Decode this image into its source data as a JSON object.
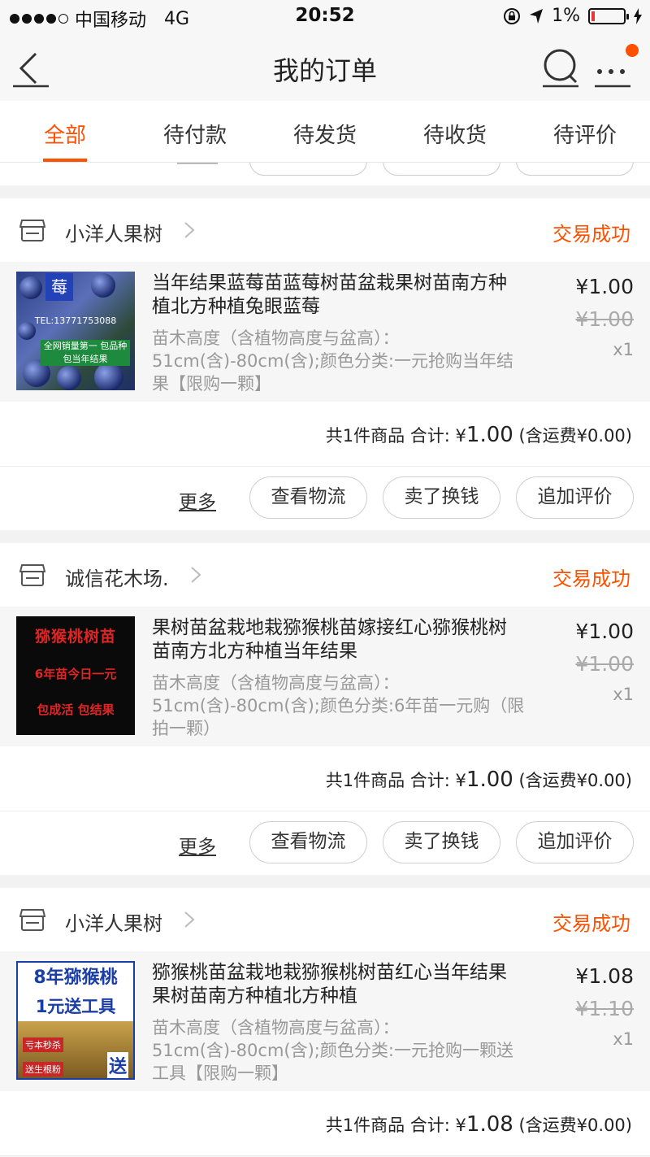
{
  "status_bar": {
    "carrier": "中国移动",
    "network": "4G",
    "time": "20:52",
    "battery": "1%"
  },
  "nav": {
    "title": "我的订单"
  },
  "tabs": [
    {
      "label": "全部",
      "active": true
    },
    {
      "label": "待付款",
      "active": false
    },
    {
      "label": "待发货",
      "active": false
    },
    {
      "label": "待收货",
      "active": false
    },
    {
      "label": "待评价",
      "active": false
    }
  ],
  "orders": [
    {
      "shop": "小洋人果树",
      "status": "交易成功",
      "item": {
        "title": "当年结果蓝莓苗蓝莓树苗盆栽果树苗南方种植北方种植兔眼蓝莓",
        "spec": "苗木高度（含植物高度与盆高）：51cm(含)-80cm(含);颜色分类:一元抢购当年结果【限购一颗】",
        "price": "¥1.00",
        "original_price": "¥1.00",
        "qty": "x1",
        "thumb_text": {
          "tag": "莓",
          "tel": "TEL:13771753088",
          "band": "全网销量第一 包品种 包当年结果"
        }
      },
      "summary": {
        "count_text": "共1件商品 合计:",
        "currency": "¥",
        "total": "1.00",
        "shipping_text": "(含运费¥0.00)"
      },
      "actions": {
        "more": "更多",
        "logistics": "查看物流",
        "resell": "卖了换钱",
        "review": "追加评价"
      }
    },
    {
      "shop": "诚信花木场.",
      "status": "交易成功",
      "item": {
        "title": "果树苗盆栽地栽猕猴桃苗嫁接红心猕猴桃树苗南方北方种植当年结果",
        "spec": "苗木高度（含植物高度与盆高）：51cm(含)-80cm(含);颜色分类:6年苗一元购（限拍一颗）",
        "price": "¥1.00",
        "original_price": "¥1.00",
        "qty": "x1",
        "thumb_text": {
          "line1": "猕猴桃树苗",
          "line2": "6年苗今日一元",
          "line3": "包成活 包结果"
        }
      },
      "summary": {
        "count_text": "共1件商品 合计:",
        "currency": "¥",
        "total": "1.00",
        "shipping_text": "(含运费¥0.00)"
      },
      "actions": {
        "more": "更多",
        "logistics": "查看物流",
        "resell": "卖了换钱",
        "review": "追加评价"
      }
    },
    {
      "shop": "小洋人果树",
      "status": "交易成功",
      "item": {
        "title": "猕猴桃苗盆栽地栽猕猴桃树苗红心当年结果果树苗南方种植北方种植",
        "spec": "苗木高度（含植物高度与盆高）：51cm(含)-80cm(含);颜色分类:一元抢购一颗送工具【限购一颗】",
        "price": "¥1.08",
        "original_price": "¥1.10",
        "qty": "x1",
        "thumb_text": {
          "line1": "8年猕猴桃",
          "line2": "1元送工具",
          "tag1": "亏本秒杀",
          "tag2": "送生根粉",
          "tag3": "送"
        }
      },
      "summary": {
        "count_text": "共1件商品 合计:",
        "currency": "¥",
        "total": "1.08",
        "shipping_text": "(含运费¥0.00)"
      }
    }
  ]
}
